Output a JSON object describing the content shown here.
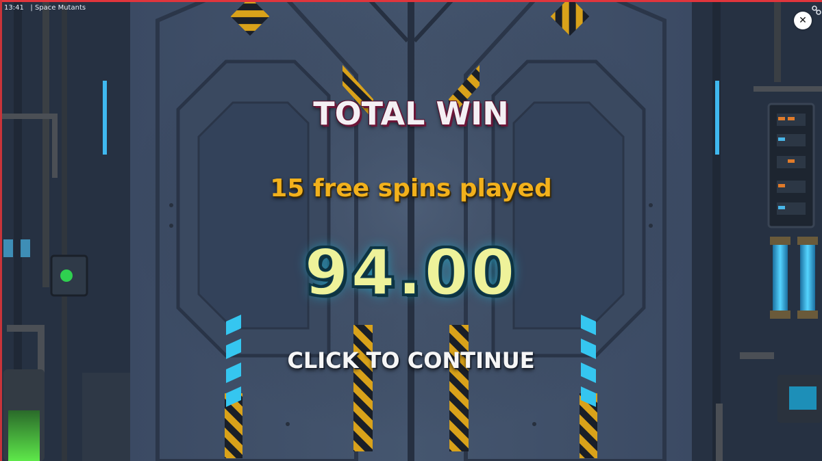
{
  "status_bar": {
    "time": "13:41",
    "separator": "|",
    "game_name": "Space Mutants"
  },
  "icons": {
    "close": "close-icon",
    "link": "link-icon"
  },
  "close_button": {
    "glyph": "✕"
  },
  "win_screen": {
    "title": "TOTAL WIN",
    "spins_text": "15 free spins played",
    "amount": "94.00",
    "continue_text": "CLICK TO CONTINUE"
  },
  "colors": {
    "background": "#2a3447",
    "title_fill": "#f4f0f4",
    "title_shadow": "#6c1638",
    "subtitle": "#f2b11c",
    "amount_fill": "#eef29a",
    "amount_outline": "#0f3544",
    "frame_accent": "#e0353c",
    "neon_blue": "#35c6f0",
    "hazard_yellow": "#d9a21a"
  }
}
